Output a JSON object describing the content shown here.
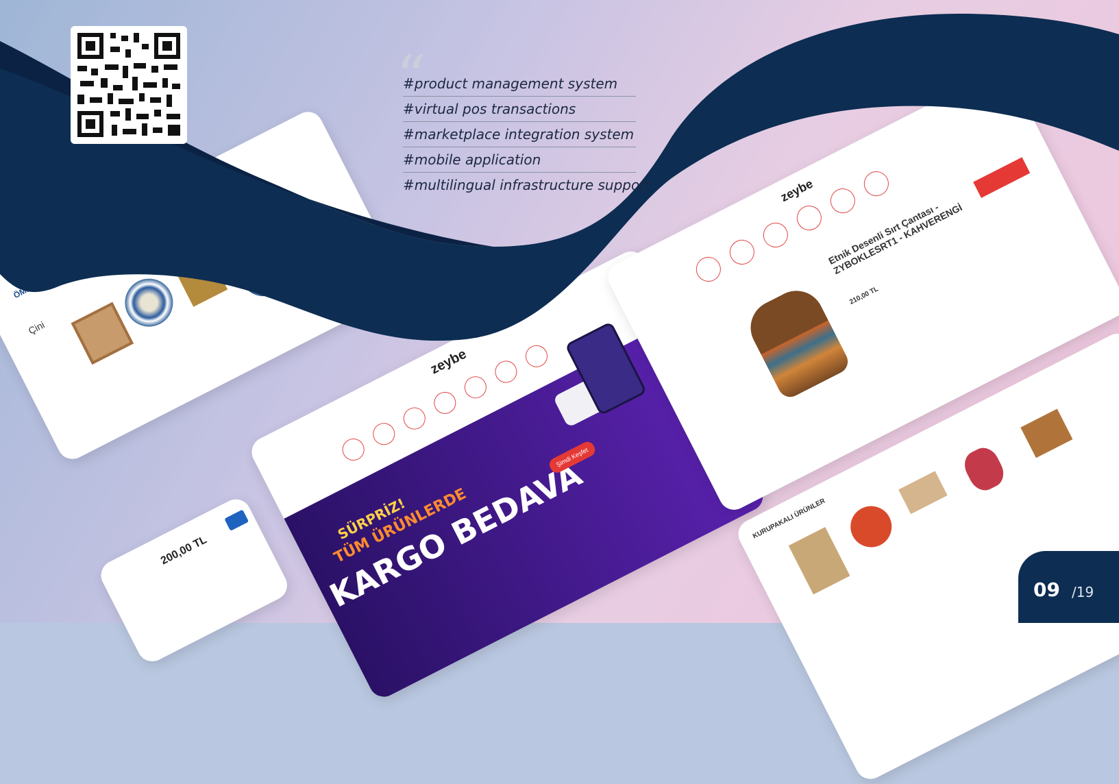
{
  "qr_code": {
    "icon": "qr-code-icon"
  },
  "quote": {
    "mark": "“"
  },
  "tags": [
    "#product management system",
    "#virtual pos transactions",
    "#marketplace integration system",
    "#mobile application",
    "#multilingual infrastructure support"
  ],
  "screenshots": {
    "center": {
      "brand": "zeybe",
      "banner_line1": "SÜRPRİZ!",
      "banner_line2": "TÜM ÜRÜNLERDE",
      "banner_line3": "KARGO BEDAVA",
      "button": "Şimdi Keşfet"
    },
    "right_top": {
      "brand": "zeybe",
      "product_title": "Etnik Desenli Sırt Çantası - ZYBOKLESRT1 - KAHVERENGİ",
      "price": "210,00 TL"
    },
    "left": {
      "brand": "ÖMEK",
      "category": "Çini"
    },
    "bottom_left": {
      "price": "200,00 TL"
    },
    "bottom_right": {
      "section_title": "KURUPAKALI ÜRÜNLER"
    }
  },
  "pagination": {
    "current": "09",
    "total": "/19"
  },
  "colors": {
    "navy": "#0d2d52",
    "accent_red": "#e53935",
    "purple": "#4a1f8c",
    "pink_bg": "#efc6dc"
  }
}
